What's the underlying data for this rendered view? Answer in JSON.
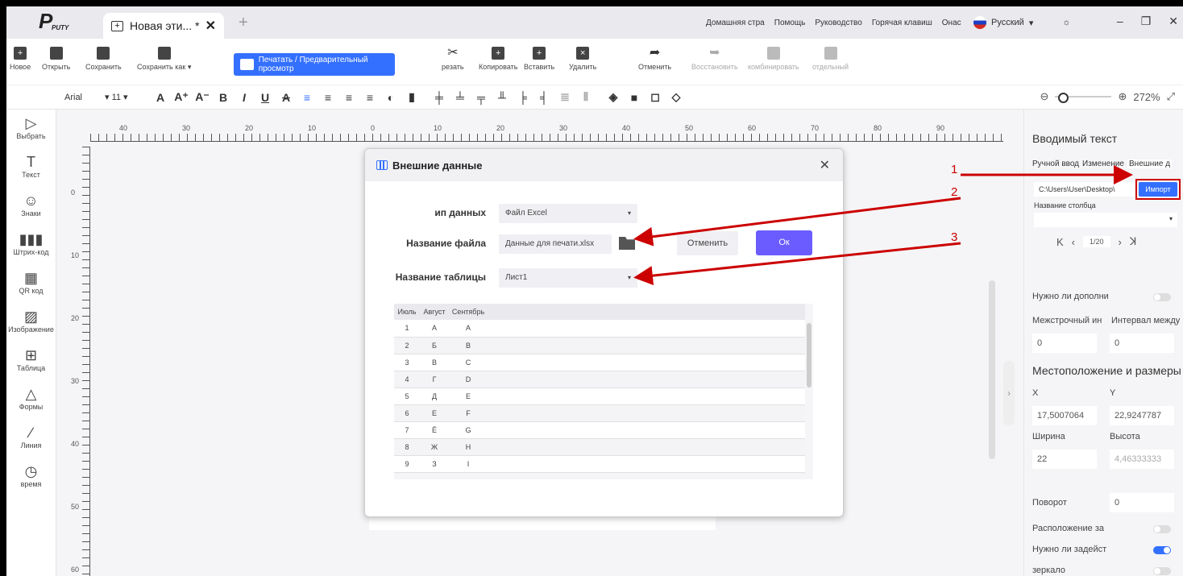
{
  "titlebar": {
    "brand": "P",
    "brand_sub": "PUTY",
    "tab_title": "Новая эти... *",
    "close_glyph": "✕",
    "new_tab_glyph": "+"
  },
  "topnav": [
    "Домашняя стра",
    "Помощь",
    "Руководство",
    "Горячая клавиш",
    "Онас"
  ],
  "language": "Русский",
  "toolbar": {
    "new": "Новое",
    "open": "Открыть",
    "save": "Сохранить",
    "save_as": "Сохранить как",
    "print": "Печатать / Предварительный просмотр",
    "cut": "резать",
    "copy": "Копировать",
    "paste": "Вставить",
    "delete": "Удалить",
    "undo": "Отменить",
    "redo": "Восстановить",
    "combine": "комбинировать",
    "separate": "отдельный"
  },
  "format": {
    "font": "Arial",
    "size": "11",
    "zoom": "272%"
  },
  "leftbar": [
    "Выбрать",
    "Текст",
    "Знаки",
    "Штрих-код",
    "QR код",
    "Изображение",
    "Таблица",
    "Формы",
    "Линия",
    "время"
  ],
  "ruler": {
    "top": [
      "40",
      "30",
      "20",
      "10",
      "0",
      "10",
      "20",
      "30",
      "40",
      "50",
      "60",
      "70",
      "80",
      "90"
    ],
    "left": [
      "0",
      "10",
      "20",
      "30",
      "40",
      "50",
      "60"
    ]
  },
  "dialog": {
    "title": "Внешние данные",
    "data_type_label": "ип данных",
    "data_type_value": "Файл Excel",
    "file_label": "Название файла",
    "file_value": "Данные для печати.xlsx",
    "sheet_label": "Название таблицы",
    "sheet_value": "Лист1",
    "cancel": "Отменить",
    "ok": "Ок",
    "table": {
      "headers": [
        "Июль",
        "Август",
        "Сентябрь"
      ],
      "rows": [
        [
          "1",
          "А",
          "A"
        ],
        [
          "2",
          "Б",
          "B"
        ],
        [
          "3",
          "В",
          "C"
        ],
        [
          "4",
          "Г",
          "D"
        ],
        [
          "5",
          "Д",
          "E"
        ],
        [
          "6",
          "Е",
          "F"
        ],
        [
          "7",
          "Ё",
          "G"
        ],
        [
          "8",
          "Ж",
          "H"
        ],
        [
          "9",
          "З",
          "I"
        ]
      ]
    }
  },
  "rightpanel": {
    "title": "Вводимый текст",
    "tabs": [
      "Ручной ввод",
      "Изменение",
      "Внешние д"
    ],
    "path": "C:\\Users\\User\\Desktop\\",
    "import": "Импорт",
    "column_label": "Название столбца",
    "pager": "1/20",
    "need_add": "Нужно ли дополни",
    "line_spacing": "Межстрочный ин",
    "char_spacing": "Интервал между",
    "line_val": "0",
    "char_val": "0",
    "pos_title": "Местоположение и размеры",
    "x_label": "X",
    "y_label": "Y",
    "x_val": "17,5007064",
    "y_val": "22,9247787",
    "w_label": "Ширина",
    "h_label": "Высота",
    "w_val": "22",
    "h_val": "4,46333333",
    "rotation": "Поворот",
    "rotation_val": "0",
    "layout": "Расположение за",
    "need_use": "Нужно ли задейст",
    "mirror": "зеркало"
  },
  "annotations": [
    "1",
    "2",
    "3"
  ]
}
